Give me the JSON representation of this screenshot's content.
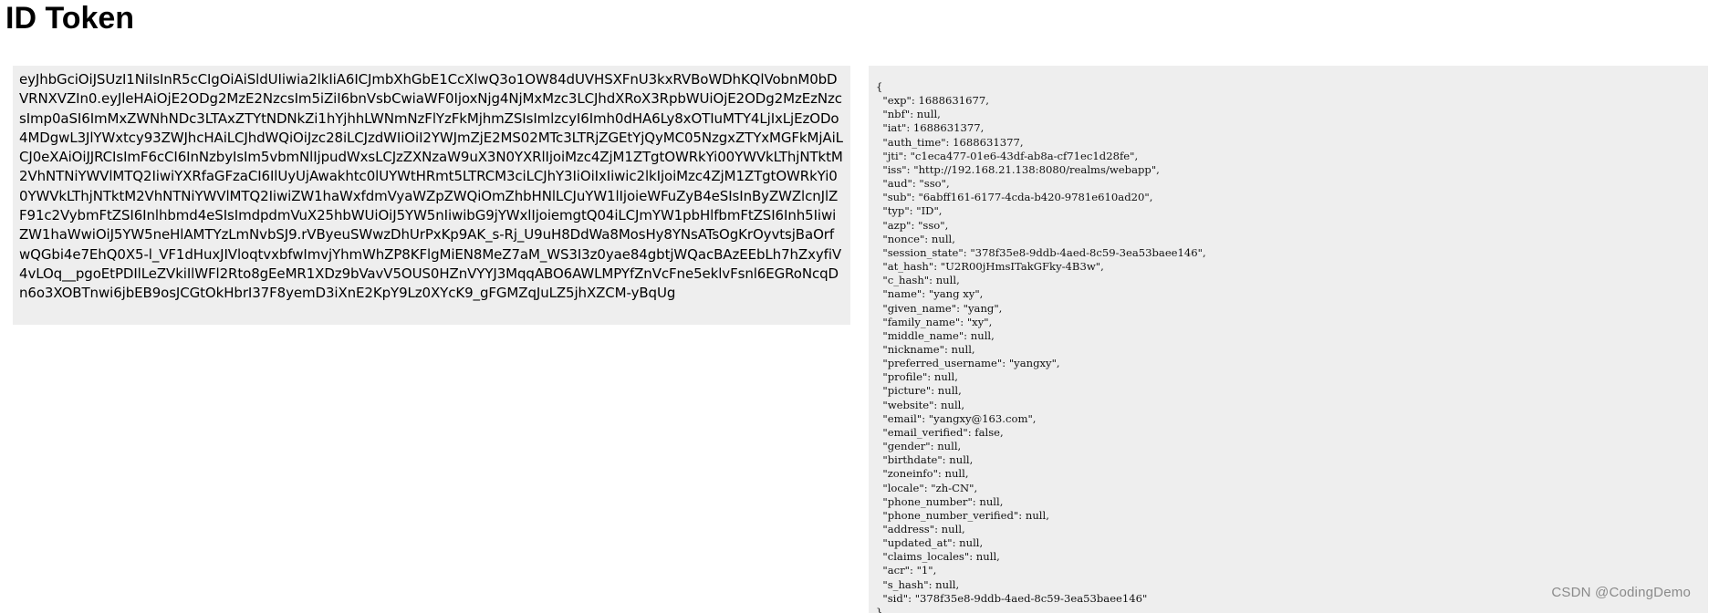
{
  "page": {
    "title": "ID Token"
  },
  "token": {
    "raw": "eyJhbGciOiJSUzI1NiIsInR5cCIgOiAiSldUIiwia2lkIiA6ICJmbXhGbE1CcXlwQ3o1OW84dUVHSXFnU3kxRVBoWDhKQlVobnM0bDVRNXVZIn0.eyJleHAiOjE2ODg2MzE2NzcsIm5iZiI6bnVsbCwiaWF0IjoxNjg4NjMxMzc3LCJhdXRoX3RpbWUiOjE2ODg2MzEzNzcsImp0aSI6ImMxZWNhNDc3LTAxZTYtNDNkZi1hYjhhLWNmNzFlYzFkMjhmZSIsImlzcyI6Imh0dHA6Ly8xOTIuMTY4LjIxLjEzODo4MDgwL3JlYWxtcy93ZWJhcHAiLCJhdWQiOiJzc28iLCJzdWIiOiI2YWJmZjE2MS02MTc3LTRjZGEtYjQyMC05NzgxZTYxMGFkMjAiLCJ0eXAiOiJJRCIsImF6cCI6InNzbyIsIm5vbmNlIjpudWxsLCJzZXNzaW9uX3N0YXRlIjoiMzc4ZjM1ZTgtOWRkYi00YWVkLThjNTktM2VhNTNiYWVlMTQ2IiwiYXRfaGFzaCI6IlUyUjAwakhtc0lUYWtHRmt5LTRCM3ciLCJhY3IiOiIxIiwic2lkIjoiMzc4ZjM1ZTgtOWRkYi00YWVkLThjNTktM2VhNTNiYWVlMTQ2IiwiZW1haWxfdmVyaWZpZWQiOmZhbHNlLCJuYW1lIjoieWFuZyB4eSIsInByZWZlcnJlZF91c2VybmFtZSI6Inlhbmd4eSIsImdpdmVuX25hbWUiOiJ5YW5nIiwibG9jYWxlIjoiemgtQ04iLCJmYW1pbHlfbmFtZSI6Inh5IiwiZW1haWwiOiJ5YW5neHlAMTYzLmNvbSJ9.rVByeuSWwzDhUrPxKp9AK_s-Rj_U9uH8DdWa8MosHy8YNsATsOgKrOyvtsjBaOrfwQGbi4e7EhQ0X5-l_VF1dHuxJIVloqtvxbfwImvjYhmWhZP8KFlgMiEN8MeZ7aM_WS3I3z0yae84gbtjWQacBAzEEbLh7hZxyfiV4vLOq__pgoEtPDIlLeZVkiIlWFl2Rto8gEeMR1XDz9bVavV5OUS0HZnVYYJ3MqqABO6AWLMPYfZnVcFne5eklvFsnl6EGRoNcqDn6o3XOBTnwi6jbEB9osJCGtOkHbrI37F8yemD3iXnE2KpY9Lz0XYcK9_gFGMZqJuLZ5jhXZCM-yBqUg"
  },
  "claims": {
    "json": "{\n  \"exp\": 1688631677,\n  \"nbf\": null,\n  \"iat\": 1688631377,\n  \"auth_time\": 1688631377,\n  \"jti\": \"c1eca477-01e6-43df-ab8a-cf71ec1d28fe\",\n  \"iss\": \"http://192.168.21.138:8080/realms/webapp\",\n  \"aud\": \"sso\",\n  \"sub\": \"6abff161-6177-4cda-b420-9781e610ad20\",\n  \"typ\": \"ID\",\n  \"azp\": \"sso\",\n  \"nonce\": null,\n  \"session_state\": \"378f35e8-9ddb-4aed-8c59-3ea53baee146\",\n  \"at_hash\": \"U2R00jHmsITakGFky-4B3w\",\n  \"c_hash\": null,\n  \"name\": \"yang xy\",\n  \"given_name\": \"yang\",\n  \"family_name\": \"xy\",\n  \"middle_name\": null,\n  \"nickname\": null,\n  \"preferred_username\": \"yangxy\",\n  \"profile\": null,\n  \"picture\": null,\n  \"website\": null,\n  \"email\": \"yangxy@163.com\",\n  \"email_verified\": false,\n  \"gender\": null,\n  \"birthdate\": null,\n  \"zoneinfo\": null,\n  \"locale\": \"zh-CN\",\n  \"phone_number\": null,\n  \"phone_number_verified\": null,\n  \"address\": null,\n  \"updated_at\": null,\n  \"claims_locales\": null,\n  \"acr\": \"1\",\n  \"s_hash\": null,\n  \"sid\": \"378f35e8-9ddb-4aed-8c59-3ea53baee146\"\n}"
  },
  "watermark": {
    "text": "CSDN @CodingDemo"
  }
}
